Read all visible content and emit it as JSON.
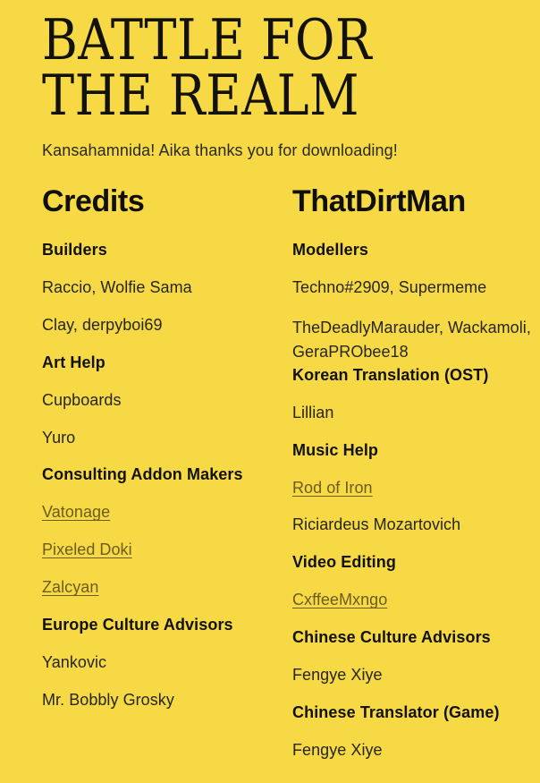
{
  "theme": {
    "background": "#f6d945",
    "text": "#26261a",
    "heading": "#12120a",
    "link": "#6b5c1e"
  },
  "masthead": {
    "title": "BATTLE FOR\nTHE REALM",
    "subtitle": "Kansahamnida! Aika thanks you for downloading!"
  },
  "columns": [
    {
      "heading": "Credits",
      "entries": [
        {
          "text": "Builders",
          "style": "cat"
        },
        {
          "text": "Raccio, Wolfie Sama",
          "style": "name"
        },
        {
          "text": "Clay, derpyboi69",
          "style": "name"
        },
        {
          "text": "Art Help",
          "style": "cat"
        },
        {
          "text": "Cupboards",
          "style": "name"
        },
        {
          "text": "Yuro",
          "style": "name"
        },
        {
          "text": "Consulting Addon Makers",
          "style": "cat"
        },
        {
          "text": "Vatonage",
          "style": "link"
        },
        {
          "text": "Pixeled Doki",
          "style": "link"
        },
        {
          "text": "Zalcyan",
          "style": "link"
        },
        {
          "text": "Europe Culture Advisors",
          "style": "cat"
        },
        {
          "text": "Yankovic",
          "style": "name"
        },
        {
          "text": "Mr. Bobbly Grosky",
          "style": "name"
        }
      ]
    },
    {
      "heading": "ThatDirtMan",
      "entries": [
        {
          "text": "Modellers",
          "style": "cat"
        },
        {
          "text": "Techno#2909, Supermeme",
          "style": "name"
        },
        {
          "text": "TheDeadlyMarauder, Wackamoli, GeraPRObee18",
          "style": "wrap"
        },
        {
          "text": "Korean Translation (OST)",
          "style": "cat"
        },
        {
          "text": "Lillian",
          "style": "name"
        },
        {
          "text": "Music Help",
          "style": "cat"
        },
        {
          "text": "Rod of Iron",
          "style": "link"
        },
        {
          "text": "Riciardeus Mozartovich",
          "style": "name"
        },
        {
          "text": "Video Editing",
          "style": "cat"
        },
        {
          "text": "CxffeeMxngo",
          "style": "link"
        },
        {
          "text": "Chinese Culture Advisors",
          "style": "cat"
        },
        {
          "text": "Fengye Xiye",
          "style": "name"
        },
        {
          "text": "Chinese Translator (Game)",
          "style": "cat"
        },
        {
          "text": "Fengye Xiye",
          "style": "name"
        }
      ]
    }
  ]
}
